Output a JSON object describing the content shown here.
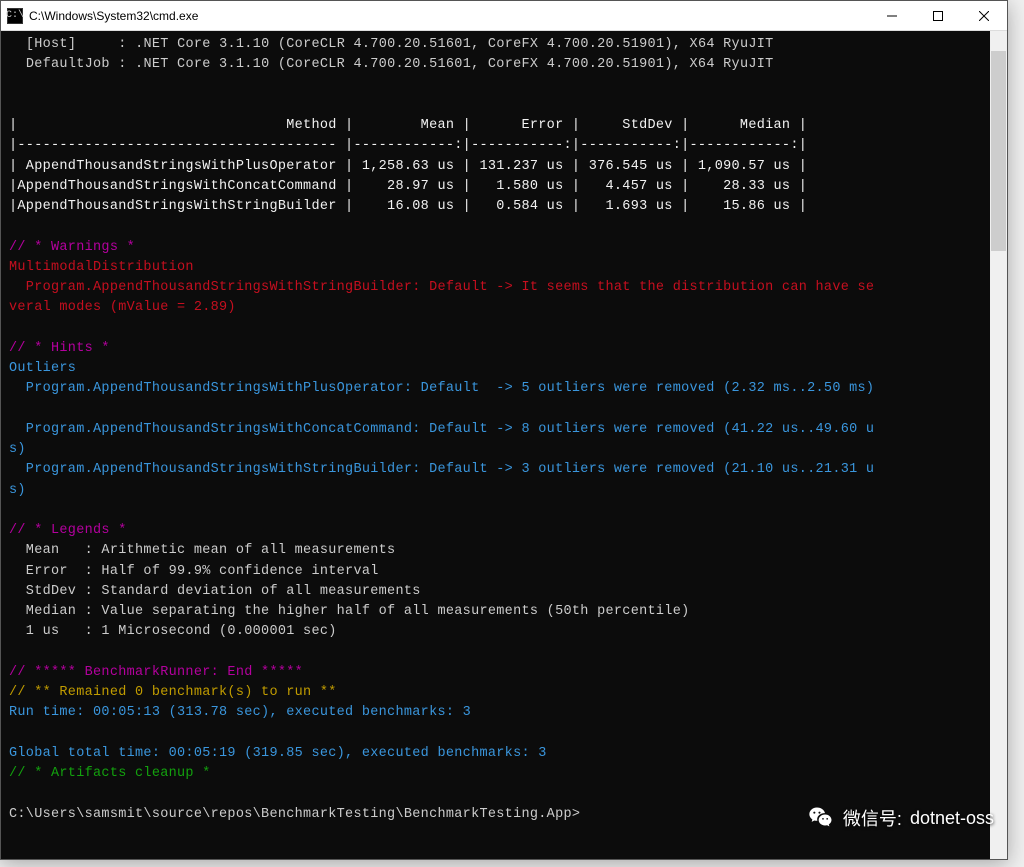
{
  "window": {
    "title": "C:\\Windows\\System32\\cmd.exe"
  },
  "runtime": {
    "host_label": "[Host]",
    "host_sep": ":",
    "host_info": ".NET Core 3.1.10 (CoreCLR 4.700.20.51601, CoreFX 4.700.20.51901), X64 RyuJIT",
    "job_label": "DefaultJob",
    "job_sep": ":",
    "job_info": ".NET Core 3.1.10 (CoreCLR 4.700.20.51601, CoreFX 4.700.20.51901), X64 RyuJIT"
  },
  "table": {
    "header_line": "|                                Method |        Mean |      Error |     StdDev |      Median |",
    "divider_line": "|-------------------------------------- |------------:|-----------:|-----------:|------------:|",
    "rows": [
      "| AppendThousandStringsWithPlusOperator | 1,258.63 us | 131.237 us | 376.545 us | 1,090.57 us |",
      "|AppendThousandStringsWithConcatCommand |    28.97 us |   1.580 us |   4.457 us |    28.33 us |",
      "|AppendThousandStringsWithStringBuilder |    16.08 us |   0.584 us |   1.693 us |    15.86 us |"
    ]
  },
  "warnings": {
    "header": "// * Warnings *",
    "dist_label": "MultimodalDistribution",
    "dist_line": "  Program.AppendThousandStringsWithStringBuilder: Default -> It seems that the distribution can have se",
    "dist_line2": "veral modes (mValue = 2.89)"
  },
  "hints": {
    "header": "// * Hints *",
    "outliers_label": "Outliers",
    "lines": [
      "  Program.AppendThousandStringsWithPlusOperator: Default  -> 5 outliers were removed (2.32 ms..2.50 ms)",
      "",
      "  Program.AppendThousandStringsWithConcatCommand: Default -> 8 outliers were removed (41.22 us..49.60 u",
      "s)",
      "  Program.AppendThousandStringsWithStringBuilder: Default -> 3 outliers were removed (21.10 us..21.31 u",
      "s)"
    ]
  },
  "legends": {
    "header": "// * Legends *",
    "lines": [
      "  Mean   : Arithmetic mean of all measurements",
      "  Error  : Half of 99.9% confidence interval",
      "  StdDev : Standard deviation of all measurements",
      "  Median : Value separating the higher half of all measurements (50th percentile)",
      "  1 us   : 1 Microsecond (0.000001 sec)"
    ]
  },
  "footer": {
    "runner_end": "// ***** BenchmarkRunner: End *****",
    "remained": "// ** Remained 0 benchmark(s) to run **",
    "run_time": "Run time: 00:05:13 (313.78 sec), executed benchmarks: 3",
    "global_time": "Global total time: 00:05:19 (319.85 sec), executed benchmarks: 3",
    "artifacts": "// * Artifacts cleanup *"
  },
  "prompt": {
    "path": "C:\\Users\\samsmit\\source\\repos\\BenchmarkTesting\\BenchmarkTesting.App>"
  },
  "watermark": {
    "label": "微信号:",
    "id": "dotnet-oss"
  }
}
